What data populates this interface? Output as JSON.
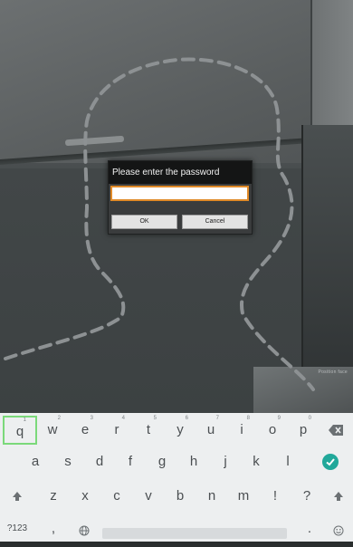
{
  "dialog": {
    "title": "Please enter the password",
    "password_value": "",
    "ok_label": "OK",
    "cancel_label": "Cancel"
  },
  "overlay": {
    "tiny_text": "Position face"
  },
  "keyboard": {
    "row1": [
      {
        "key": "q",
        "hint": "1"
      },
      {
        "key": "w",
        "hint": "2"
      },
      {
        "key": "e",
        "hint": "3"
      },
      {
        "key": "r",
        "hint": "4"
      },
      {
        "key": "t",
        "hint": "5"
      },
      {
        "key": "y",
        "hint": "6"
      },
      {
        "key": "u",
        "hint": "7"
      },
      {
        "key": "i",
        "hint": "8"
      },
      {
        "key": "o",
        "hint": "9"
      },
      {
        "key": "p",
        "hint": "0"
      }
    ],
    "row2": [
      "a",
      "s",
      "d",
      "f",
      "g",
      "h",
      "j",
      "k",
      "l"
    ],
    "row3": [
      "z",
      "x",
      "c",
      "v",
      "b",
      "n",
      "m",
      "!",
      "?"
    ],
    "symbols_label": "?123",
    "comma_label": ",",
    "period_label": ".",
    "icons": {
      "backspace": "backspace-icon",
      "enter": "check-circle-icon",
      "shift_left": "shift-icon",
      "shift_right": "shift-icon",
      "globe": "globe-icon",
      "emoji": "emoji-icon"
    },
    "accent_color": "#21a89a",
    "focus_color": "#7bd97a"
  }
}
